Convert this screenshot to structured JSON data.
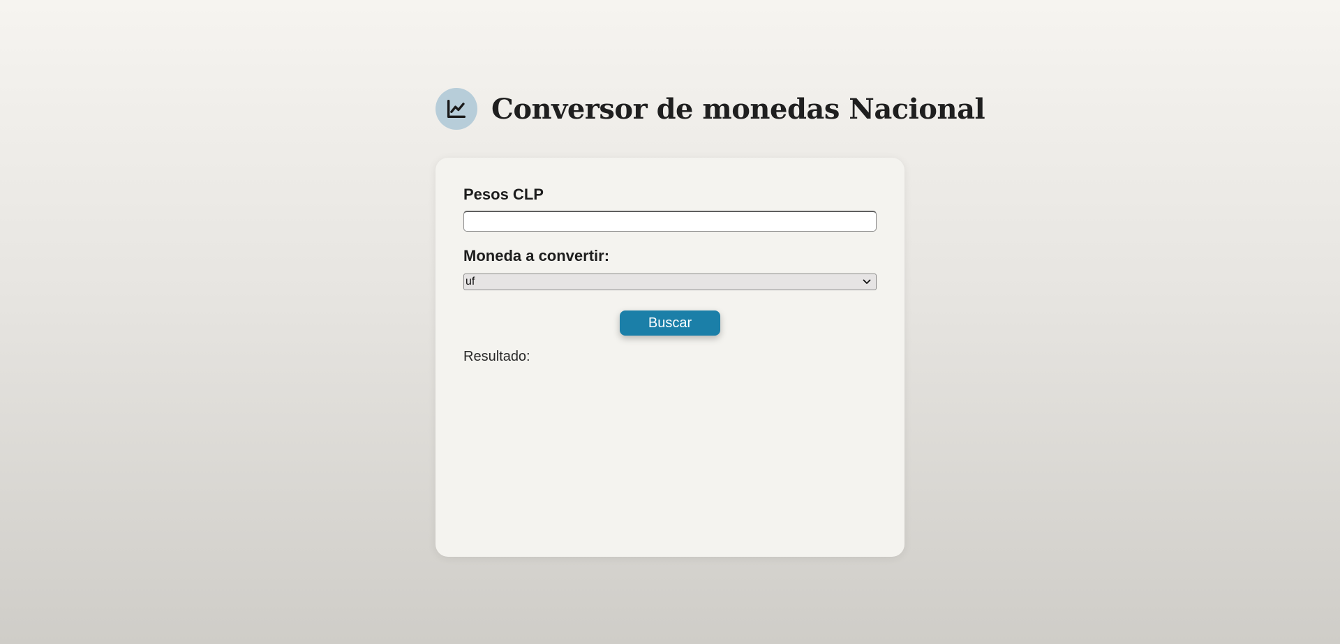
{
  "header": {
    "title": "Conversor de monedas Nacional",
    "logo_icon": "line-chart-icon",
    "logo_bg": "#b7cdd9"
  },
  "form": {
    "amount_label": "Pesos CLP",
    "amount_value": "",
    "amount_placeholder": "",
    "currency_label": "Moneda a convertir:",
    "currency_selected": "uf",
    "button_label": "Buscar",
    "button_color": "#1b7fa8",
    "result_label": "Resultado:",
    "result_value": ""
  }
}
